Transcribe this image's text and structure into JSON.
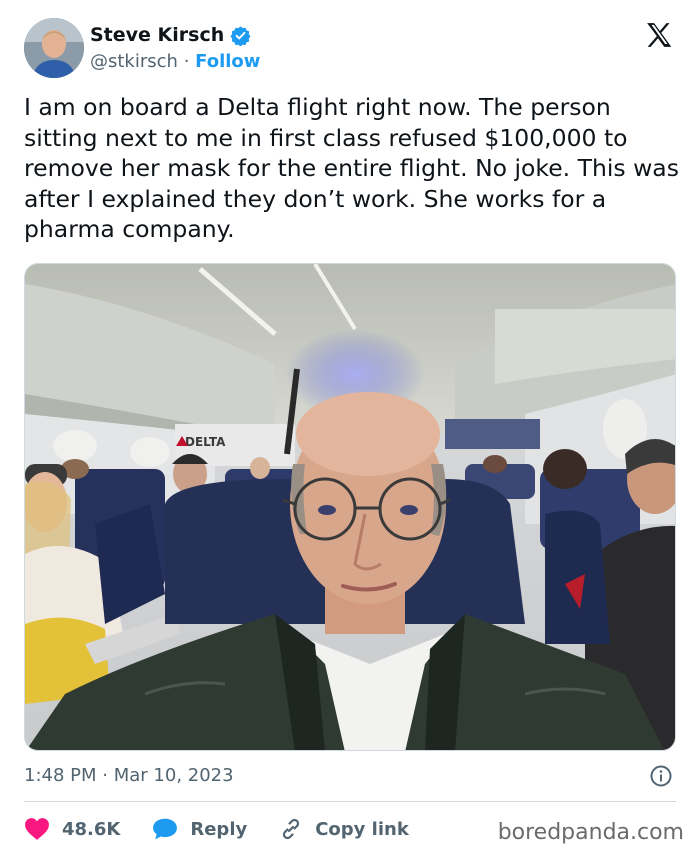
{
  "user": {
    "name": "Steve Kirsch",
    "handle": "@stkirsch",
    "separator": "·",
    "follow_label": "Follow",
    "verified": true
  },
  "tweet": {
    "text": "I am on board a Delta flight right now. The person sitting next to me in first class refused $100,000 to remove her mask for the entire flight. No joke. This was after I explained they don’t work. She works for a pharma company."
  },
  "media": {
    "bulkhead_text": "DELTA"
  },
  "meta": {
    "time": "1:48 PM",
    "separator": "·",
    "date": "Mar 10, 2023"
  },
  "actions": {
    "likes": "48.6K",
    "reply_label": "Reply",
    "copy_link_label": "Copy link"
  },
  "watermark": "boredpanda.com",
  "colors": {
    "accent": "#1d9bf0",
    "like": "#f91880",
    "text": "#0f1419",
    "muted": "#536471"
  },
  "icons": [
    "verified-badge-icon",
    "x-logo-icon",
    "info-icon",
    "heart-icon",
    "reply-bubble-icon",
    "link-icon"
  ]
}
